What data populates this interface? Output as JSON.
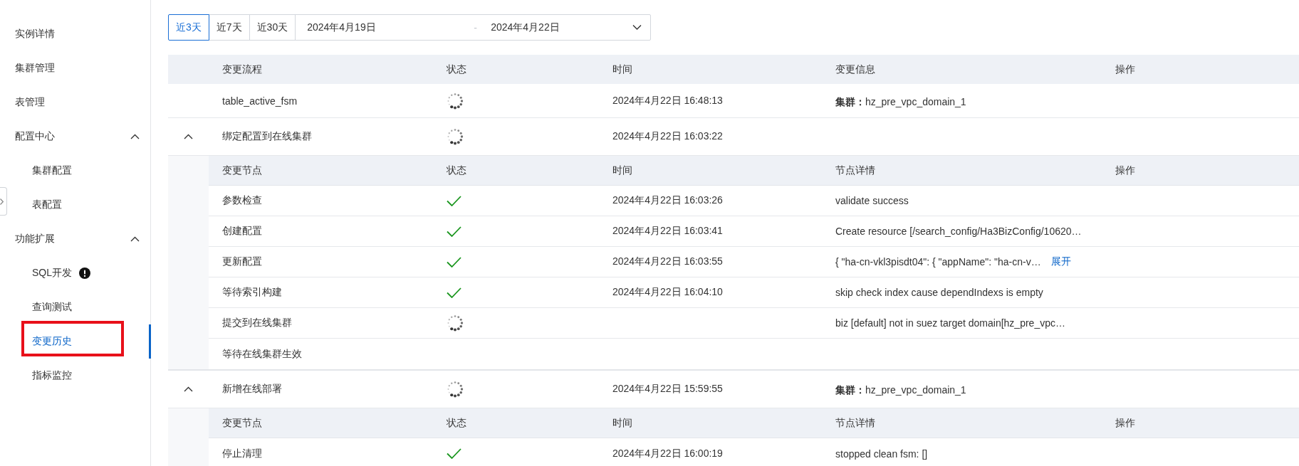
{
  "sidebar": {
    "items": [
      {
        "label": "实例详情",
        "selected": false,
        "highlighted": false,
        "alert": false
      },
      {
        "label": "集群管理",
        "selected": false,
        "highlighted": false,
        "alert": false
      },
      {
        "label": "表管理",
        "selected": false,
        "highlighted": false,
        "alert": false
      },
      {
        "label": "配置中心",
        "selected": false,
        "highlighted": false,
        "alert": false,
        "expanded": true,
        "children": [
          {
            "label": "集群配置",
            "selected": false,
            "highlighted": false,
            "alert": false
          },
          {
            "label": "表配置",
            "selected": false,
            "highlighted": false,
            "alert": false
          }
        ]
      },
      {
        "label": "功能扩展",
        "selected": false,
        "highlighted": false,
        "alert": false,
        "expanded": true,
        "children": [
          {
            "label": "SQL开发",
            "selected": false,
            "highlighted": false,
            "alert": true
          },
          {
            "label": "查询测试",
            "selected": false,
            "highlighted": false,
            "alert": false
          },
          {
            "label": "变更历史",
            "selected": true,
            "highlighted": true,
            "alert": false
          },
          {
            "label": "指标监控",
            "selected": false,
            "highlighted": false,
            "alert": false
          }
        ]
      }
    ]
  },
  "range_tabs": [
    {
      "label": "近3天",
      "selected": true
    },
    {
      "label": "近7天",
      "selected": false
    },
    {
      "label": "近30天",
      "selected": false
    }
  ],
  "date_range": {
    "start": "2024年4月19日",
    "separator": "-",
    "end": "2024年4月22日"
  },
  "table": {
    "columns": [
      "变更流程",
      "状态",
      "时间",
      "变更信息",
      "操作"
    ],
    "rows": [
      {
        "kind": "simple",
        "flow": "table_active_fsm",
        "running": true,
        "done": false,
        "time": "2024年4月22日 16:48:13",
        "info": "**集群：**hz_pre_vpc_domain_1"
      },
      {
        "kind": "group",
        "expanded": true,
        "flow": "绑定配置到在线集群",
        "running": true,
        "done": false,
        "time": "2024年4月22日 16:03:22",
        "nodes": {
          "columns": [
            "变更节点",
            "状态",
            "时间",
            "节点详情",
            "操作"
          ],
          "rows": [
            {
              "node": "参数检查",
              "running": false,
              "done": true,
              "time": "2024年4月22日 16:03:26",
              "detail": "validate success"
            },
            {
              "node": "创建配置",
              "running": false,
              "done": true,
              "time": "2024年4月22日 16:03:41",
              "detail": "Create resource [/search_config/Ha3BizConfig/10620…"
            },
            {
              "node": "更新配置",
              "running": false,
              "done": true,
              "time": "2024年4月22日 16:03:55",
              "detail": "{ \"ha-cn-vkl3pisdt04\": { \"appName\": \"ha-cn-v…",
              "link": "展开"
            },
            {
              "node": "等待索引构建",
              "running": false,
              "done": true,
              "time": "2024年4月22日 16:04:10",
              "detail": "skip check index cause dependIndexs is empty"
            },
            {
              "node": "提交到在线集群",
              "running": true,
              "done": false,
              "detail": "biz [default] not in suez target domain[hz_pre_vpc…"
            },
            {
              "node": "等待在线集群生效",
              "running": false,
              "done": false
            }
          ]
        }
      },
      {
        "kind": "group",
        "expanded": true,
        "flow": "新增在线部署",
        "running": true,
        "done": false,
        "time": "2024年4月22日 15:59:55",
        "info": "**集群：**hz_pre_vpc_domain_1",
        "nodes": {
          "columns": [
            "变更节点",
            "状态",
            "时间",
            "节点详情",
            "操作"
          ],
          "rows": [
            {
              "node": "停止清理",
              "running": false,
              "done": true,
              "time": "2024年4月22日 16:00:19",
              "detail": "stopped clean fsm: []"
            }
          ]
        }
      }
    ]
  }
}
